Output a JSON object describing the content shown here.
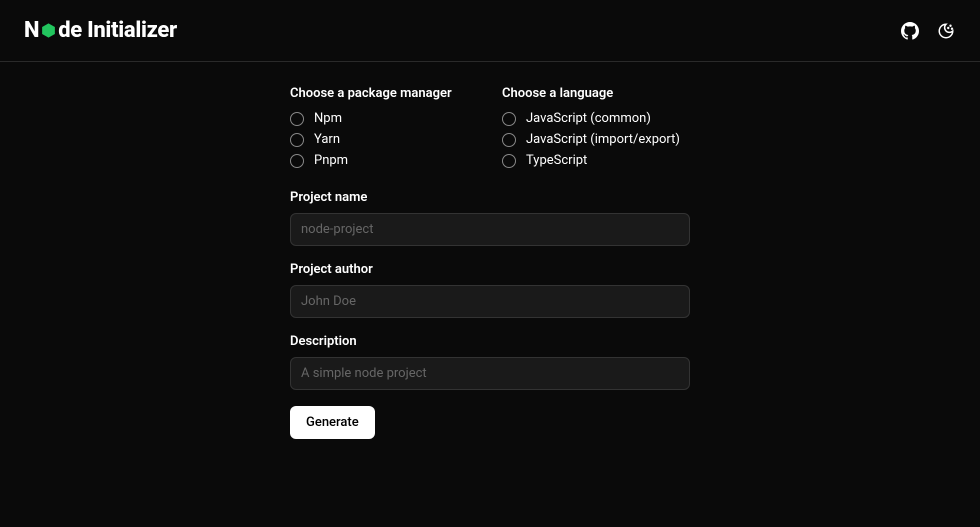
{
  "header": {
    "title_before": "N",
    "title_after": "de Initializer"
  },
  "form": {
    "package_manager": {
      "label": "Choose a package manager",
      "options": [
        "Npm",
        "Yarn",
        "Pnpm"
      ]
    },
    "language": {
      "label": "Choose a language",
      "options": [
        "JavaScript (common)",
        "JavaScript (import/export)",
        "TypeScript"
      ]
    },
    "project_name": {
      "label": "Project name",
      "placeholder": "node-project",
      "value": ""
    },
    "project_author": {
      "label": "Project author",
      "placeholder": "John Doe",
      "value": ""
    },
    "description": {
      "label": "Description",
      "placeholder": "A simple node project",
      "value": ""
    },
    "generate_label": "Generate"
  }
}
